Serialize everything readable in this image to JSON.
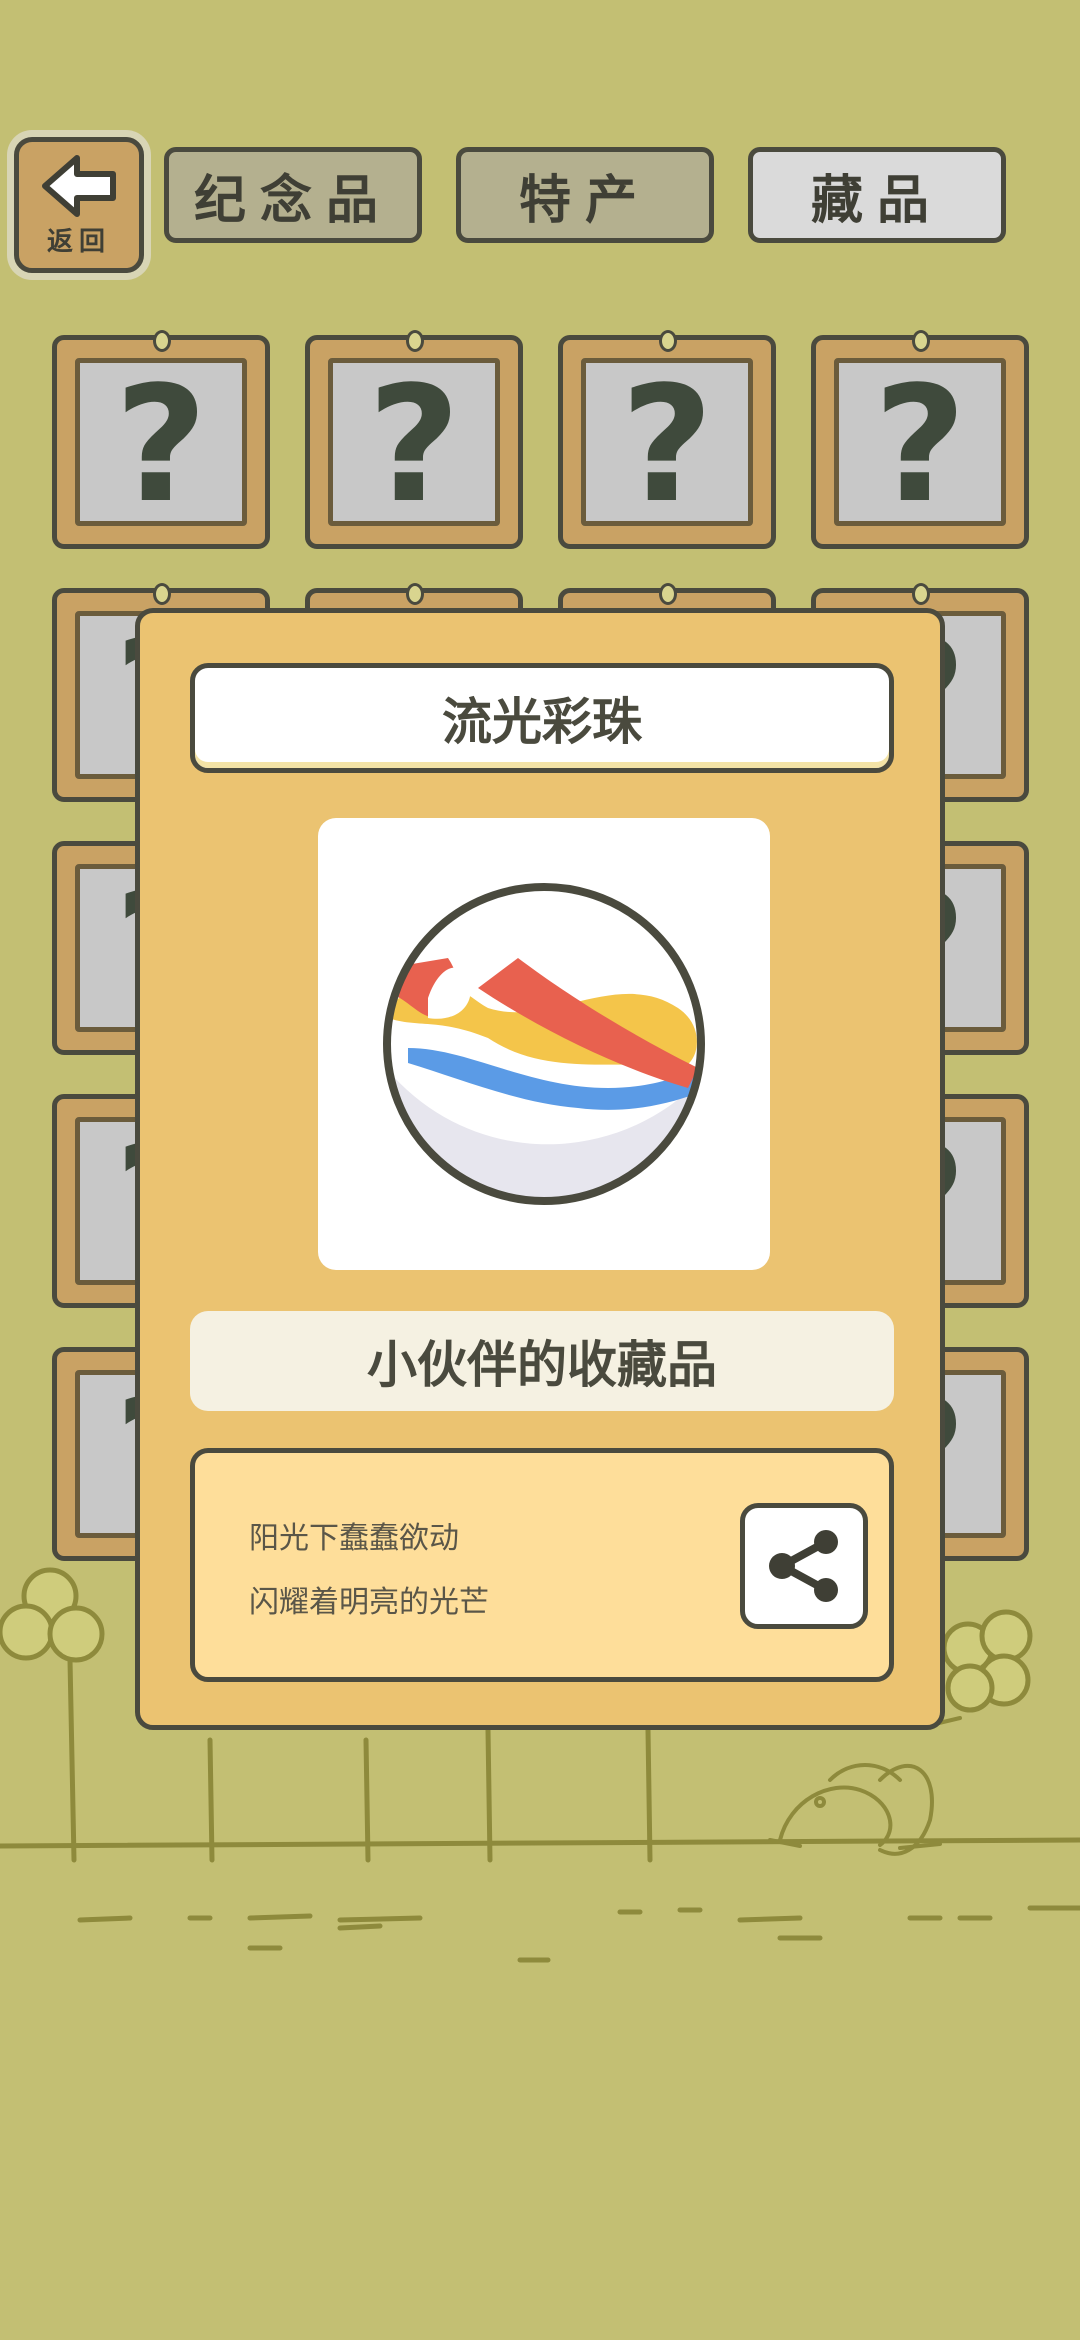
{
  "header": {
    "back_label": "返回",
    "tabs": [
      {
        "label": "纪念品",
        "active": false
      },
      {
        "label": "特产",
        "active": false
      },
      {
        "label": "藏品",
        "active": true
      }
    ]
  },
  "grid": {
    "placeholder": "?",
    "columns": 4,
    "visible_rows": 5
  },
  "item": {
    "name": "流光彩珠",
    "category": "小伙伴的收藏品",
    "description": [
      "阳光下蠢蠢欲动",
      "闪耀着明亮的光芒"
    ],
    "icon": "marble-icon"
  },
  "actions": {
    "share_icon": "share-icon"
  },
  "colors": {
    "background": "#c3bf73",
    "panel": "#ebc371",
    "frame_wood": "#c9a264",
    "outline": "#4a4a3e"
  }
}
